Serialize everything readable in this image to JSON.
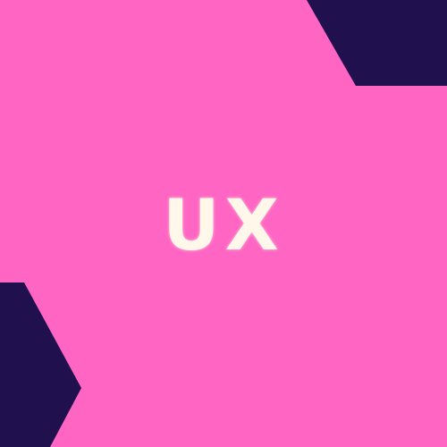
{
  "graphic": {
    "text": "UX",
    "background_color": "#ff66c4",
    "accent_color": "#21104e",
    "text_color": "#fff7ea"
  }
}
